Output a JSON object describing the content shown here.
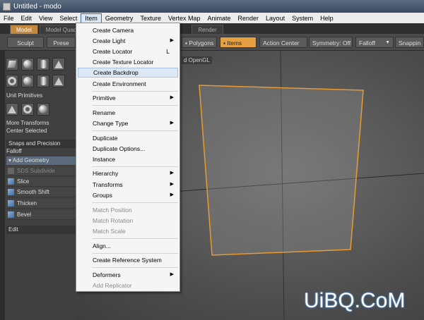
{
  "window": {
    "title": "Untitled - modo"
  },
  "menubar": {
    "items": [
      "File",
      "Edit",
      "View",
      "Select",
      "Item",
      "Geometry",
      "Texture",
      "Vertex Map",
      "Animate",
      "Render",
      "Layout",
      "System",
      "Help"
    ]
  },
  "layout_tabs": {
    "model": "Model",
    "model_quad": "Model Quad",
    "render": "Render"
  },
  "toolbar": {
    "sculpt": "Sculpt",
    "preset": "Prese",
    "polygons": "Polygons",
    "items": "Items",
    "action_center": "Action Center",
    "symmetry": "Symmetry: Off",
    "falloff": "Falloff",
    "snapping": "Snappin"
  },
  "left_panel": {
    "unit_primitives": "Unit Primitives",
    "more_transforms": "More Transforms",
    "center_selected": "Center Selected",
    "snaps_precision": "Snaps and Precision",
    "falloff": "Falloff",
    "add_geometry": "Add Geometry",
    "sds_subdivide": "SDS Subdivide",
    "slice": "Slice",
    "smooth_shift": "Smooth Shift",
    "thicken": "Thicken",
    "bevel": "Bevel",
    "edit": "Edit"
  },
  "viewport": {
    "label": "d OpenGL",
    "plane_color": "#e89b30"
  },
  "item_menu": {
    "create_camera": "Create Camera",
    "create_light": "Create Light",
    "create_locator": "Create Locator",
    "locator_shortcut": "L",
    "create_texture_locator": "Create Texture Locator",
    "create_backdrop": "Create Backdrop",
    "create_environment": "Create Environment",
    "primitive": "Primitive",
    "rename": "Rename",
    "change_type": "Change Type",
    "duplicate": "Duplicate",
    "duplicate_options": "Duplicate Options...",
    "instance": "Instance",
    "hierarchy": "Hierarchy",
    "transforms": "Transforms",
    "groups": "Groups",
    "match_position": "Match Position",
    "match_rotation": "Match Rotation",
    "match_scale": "Match Scale",
    "align": "Align...",
    "create_reference_system": "Create Reference System",
    "deformers": "Deformers",
    "add_replicator": "Add Replicator"
  },
  "watermark": "UiBQ.CoM"
}
